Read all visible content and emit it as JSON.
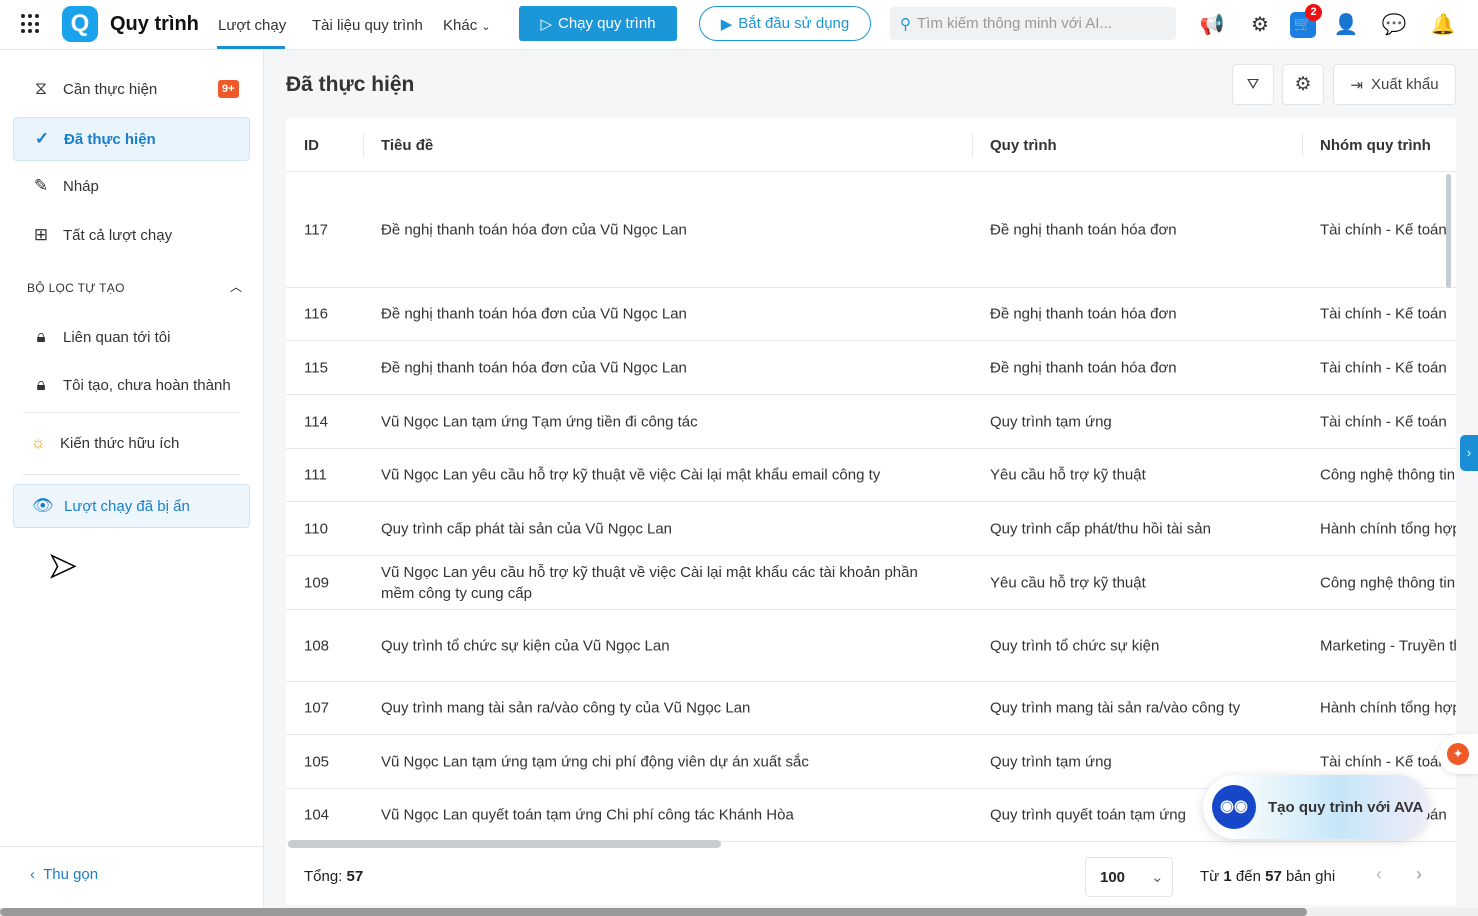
{
  "header": {
    "app_title": "Quy trình",
    "logo": "Q",
    "tabs": [
      {
        "label": "Lượt chạy"
      },
      {
        "label": "Tài liệu quy trình"
      },
      {
        "label": "Khác"
      }
    ],
    "run_button": "Chạy quy trình",
    "start_button": "Bắt đầu sử dụng",
    "search_placeholder": "Tìm kiếm thông minh với AI...",
    "cart_badge": "2"
  },
  "sidebar": {
    "items": [
      {
        "label": "Cần thực hiện",
        "badge": "9+"
      },
      {
        "label": "Đã thực hiện"
      },
      {
        "label": "Nháp"
      },
      {
        "label": "Tất cả lượt chạy"
      }
    ],
    "section_title": "BỘ LỌC TỰ TẠO",
    "filters": [
      {
        "label": "Liên quan tới tôi"
      },
      {
        "label": "Tôi tạo, chưa hoàn thành"
      }
    ],
    "knowledge": "Kiến thức hữu ích",
    "hidden": "Lượt chạy đã bị ẩn",
    "collapse": "Thu gọn"
  },
  "main": {
    "title": "Đã thực hiện",
    "export": "Xuất khẩu",
    "columns": [
      "ID",
      "Tiêu đề",
      "Quy trình",
      "Nhóm quy trình"
    ],
    "rows": [
      {
        "id": "117",
        "title": "Đề nghị thanh toán hóa đơn của Vũ Ngọc Lan",
        "process": "Đề nghị thanh toán hóa đơn",
        "group": "Tài chính - Kế toán"
      },
      {
        "id": "116",
        "title": "Đề nghị thanh toán hóa đơn của Vũ Ngọc Lan",
        "process": "Đề nghị thanh toán hóa đơn",
        "group": "Tài chính - Kế toán"
      },
      {
        "id": "115",
        "title": "Đề nghị thanh toán hóa đơn của Vũ Ngọc Lan",
        "process": "Đề nghị thanh toán hóa đơn",
        "group": "Tài chính - Kế toán"
      },
      {
        "id": "114",
        "title": "Vũ Ngọc Lan tạm ứng Tạm ứng tiền đi công tác",
        "process": "Quy trình tạm ứng",
        "group": "Tài chính - Kế toán"
      },
      {
        "id": "111",
        "title": "Vũ Ngọc Lan yêu cầu hỗ trợ kỹ thuật về việc Cài lại mật khẩu email công ty",
        "process": "Yêu cầu hỗ trợ kỹ thuật",
        "group": "Công nghệ thông tin"
      },
      {
        "id": "110",
        "title": "Quy trình cấp phát tài sản của Vũ Ngọc Lan",
        "process": "Quy trình cấp phát/thu hồi tài sản",
        "group": "Hành chính tổng hợp"
      },
      {
        "id": "109",
        "title": "Vũ Ngọc Lan yêu cầu hỗ trợ kỹ thuật về việc Cài lại mật khẩu các tài khoản phần mềm công ty cung cấp",
        "process": "Yêu cầu hỗ trợ kỹ thuật",
        "group": "Công nghệ thông tin"
      },
      {
        "id": "108",
        "title": "Quy trình tổ chức sự kiện của Vũ Ngọc Lan",
        "process": "Quy trình tổ chức sự kiện",
        "group": "Marketing - Truyền thông"
      },
      {
        "id": "107",
        "title": "Quy trình mang tài sản ra/vào công ty của Vũ Ngọc Lan",
        "process": "Quy trình mang tài sản ra/vào công ty",
        "group": "Hành chính tổng hợp"
      },
      {
        "id": "105",
        "title": "Vũ Ngọc Lan tạm ứng tạm ứng chi phí động viên dự án xuất sắc",
        "process": "Quy trình tạm ứng",
        "group": "Tài chính - Kế toán"
      },
      {
        "id": "104",
        "title": "Vũ Ngọc Lan quyết toán tạm ứng Chi phí công tác Khánh Hòa",
        "process": "Quy trình quyết toán tạm ứng",
        "group": "Tài chính - Kế toán"
      }
    ],
    "footer": {
      "total_label": "Tổng:",
      "total": "57",
      "page_size": "100",
      "range_from_label": "Từ",
      "range_from": "1",
      "range_to_label": "đến",
      "range_to": "57",
      "range_suffix": "bản ghi"
    }
  },
  "ava": {
    "label": "Tạo quy trình với AVA"
  },
  "colors": {
    "accent": "#1a96d9",
    "badge": "#f05a28"
  }
}
